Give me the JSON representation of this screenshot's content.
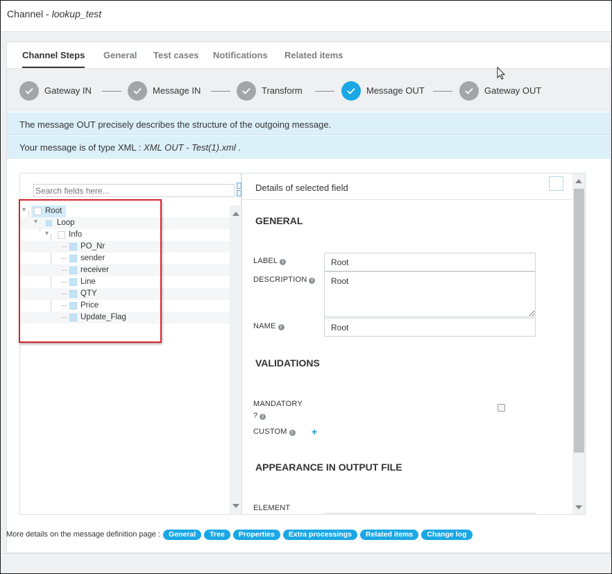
{
  "window": {
    "title_prefix": "Channel - ",
    "title_name": "lookup_test"
  },
  "tabs": [
    {
      "label": "Channel Steps",
      "active": true
    },
    {
      "label": "General"
    },
    {
      "label": "Test cases"
    },
    {
      "label": "Notifications"
    },
    {
      "label": "Related items"
    }
  ],
  "steps": [
    {
      "label": "Gateway IN",
      "state": "done"
    },
    {
      "label": "Message IN",
      "state": "done"
    },
    {
      "label": "Transform",
      "state": "done"
    },
    {
      "label": "Message OUT",
      "state": "active"
    },
    {
      "label": "Gateway OUT",
      "state": "done"
    }
  ],
  "info": {
    "line1": "The message OUT precisely describes the structure of the outgoing message.",
    "line2_prefix": "Your message is of type XML : ",
    "line2_file": "XML OUT - Test(1).xml",
    "line2_suffix": " ."
  },
  "tree": {
    "search_placeholder": "Search fields here...",
    "nodes": [
      {
        "label": "Root",
        "selected": true
      },
      {
        "label": "Loop"
      },
      {
        "label": "Info"
      },
      {
        "label": "PO_Nr"
      },
      {
        "label": "sender"
      },
      {
        "label": "receiver"
      },
      {
        "label": "Line"
      },
      {
        "label": "QTY"
      },
      {
        "label": "Price"
      },
      {
        "label": "Update_Flag"
      }
    ]
  },
  "details": {
    "header": "Details of selected field",
    "general_title": "GENERAL",
    "label_label": "LABEL",
    "label_value": "Root",
    "description_label": "DESCRIPTION",
    "description_value": "Root",
    "name_label": "NAME",
    "name_value": "Root",
    "validations_title": "VALIDATIONS",
    "mandatory_label_1": "MANDATORY",
    "mandatory_label_2": "?",
    "mandatory_checked": false,
    "custom_label": "CUSTOM",
    "custom_add": "+",
    "appearance_title": "APPEARANCE IN OUTPUT FILE",
    "element_label": "ELEMENT"
  },
  "footer": {
    "text": "More details on the message definition page : ",
    "links": [
      "General",
      "Tree",
      "Properties",
      "Extra processings",
      "Related items",
      "Change log"
    ]
  },
  "colors": {
    "accent": "#1aa7e5",
    "step_done": "#a3a6a9",
    "info_bg": "#dcf0fa",
    "highlight_red": "#d9262c"
  },
  "icons": {
    "step_check": "check-icon",
    "info": "info-icon",
    "cursor": "mouse-pointer-icon"
  }
}
